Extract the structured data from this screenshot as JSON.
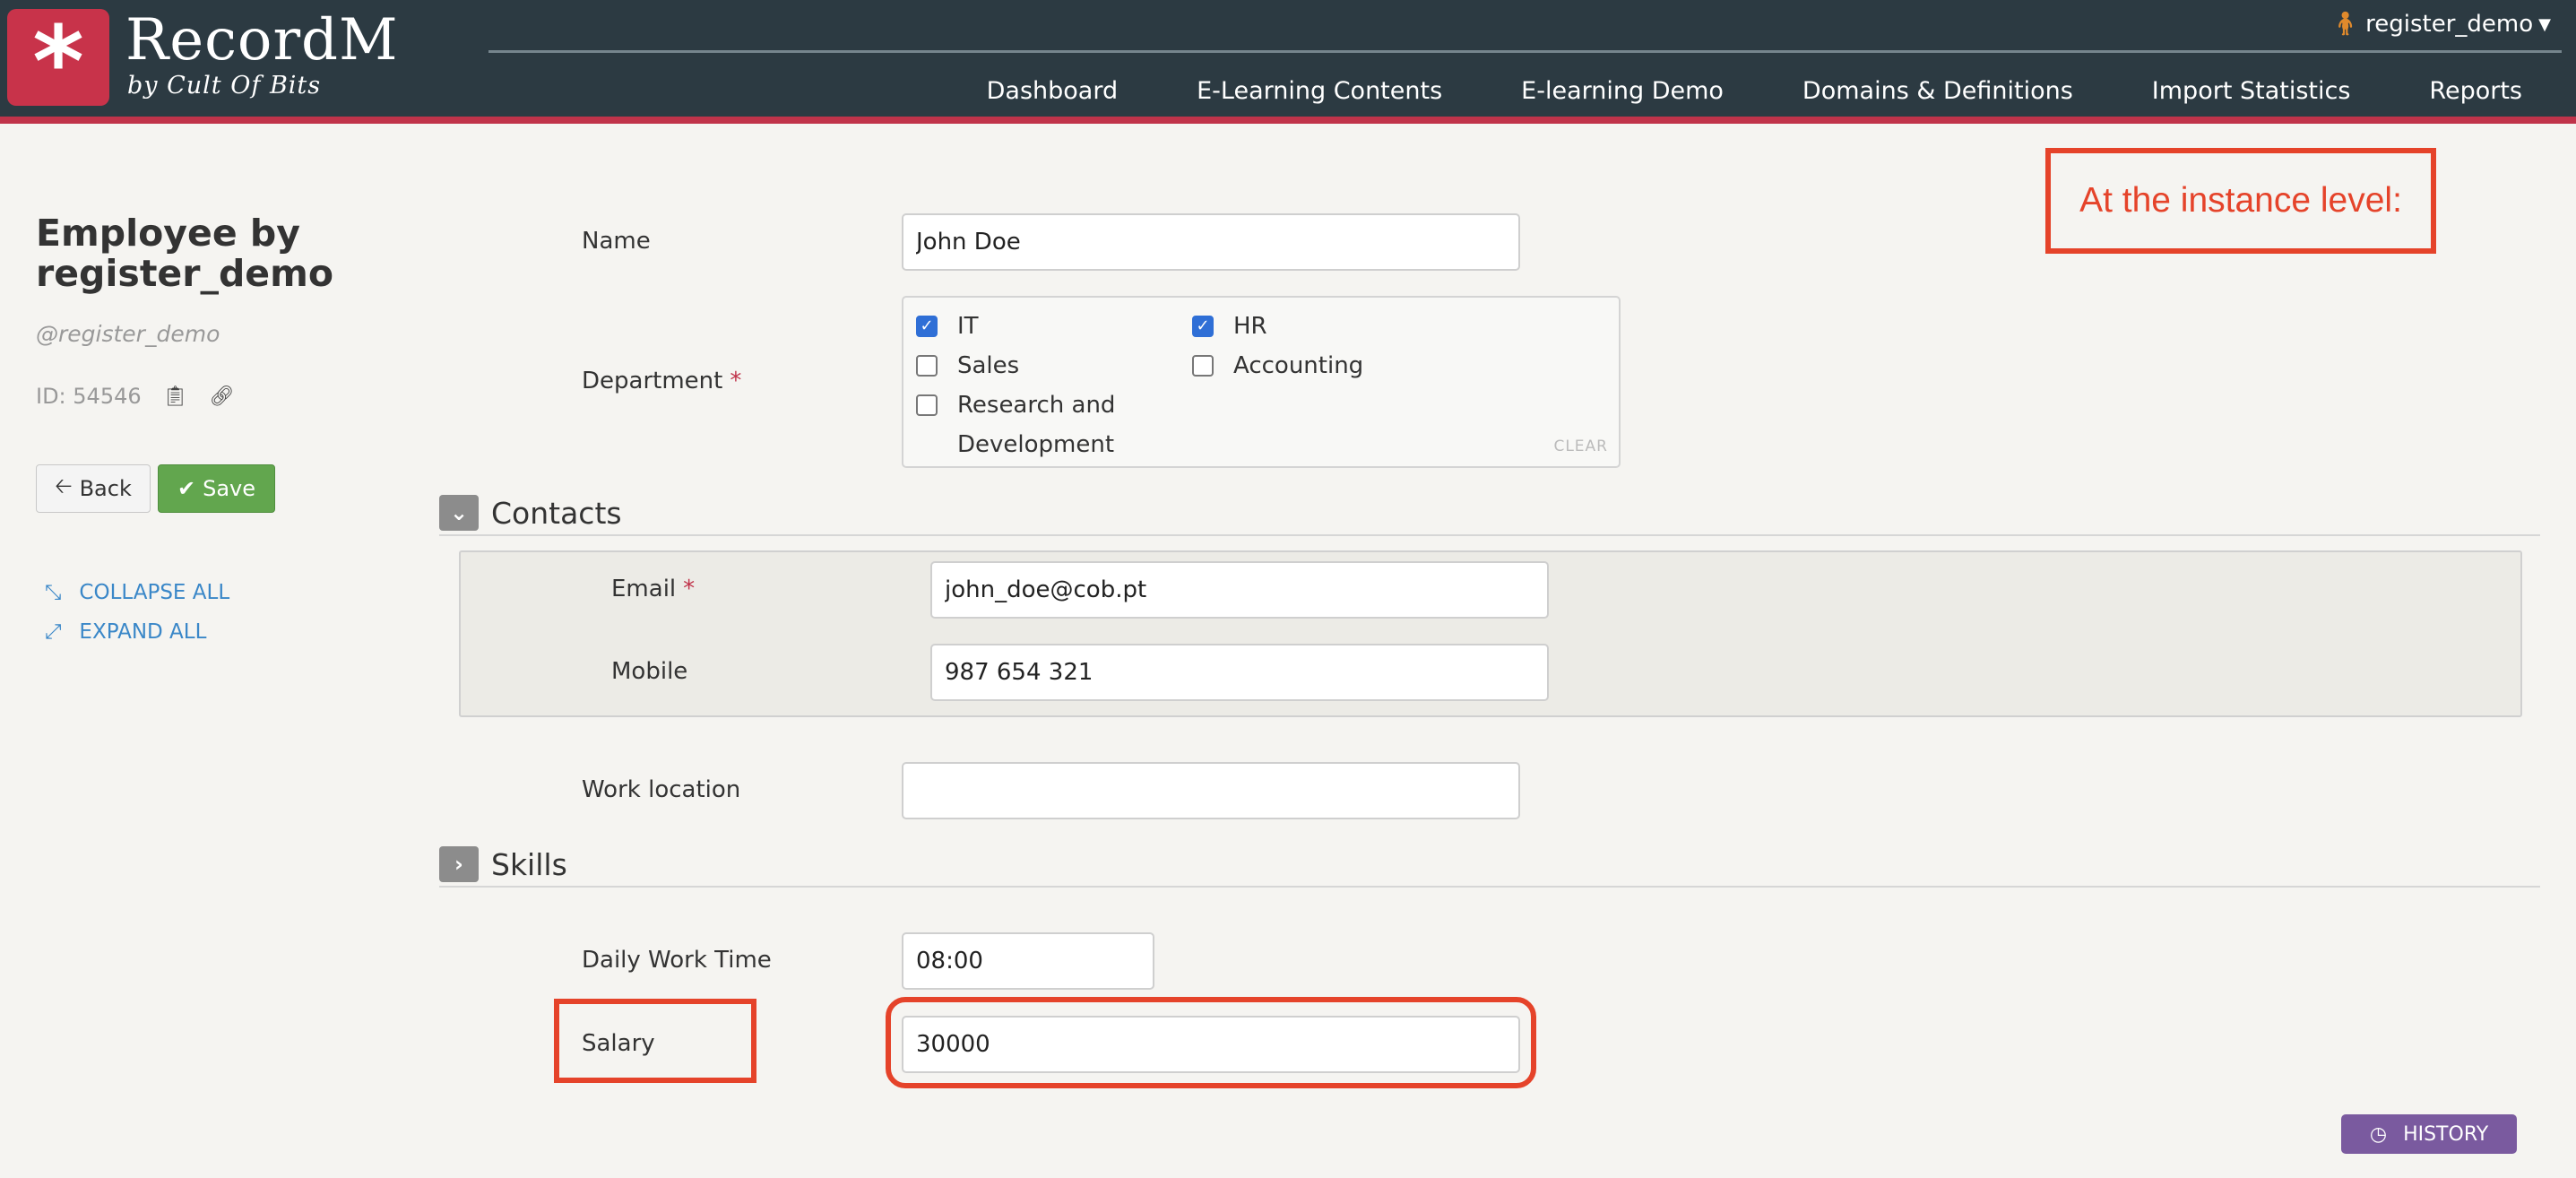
{
  "header": {
    "logo_symbol": "*",
    "app_name": "RecordM",
    "app_tagline": "by Cult Of Bits",
    "user": "register_demo",
    "nav": [
      "Dashboard",
      "E-Learning Contents",
      "E-learning Demo",
      "Domains & Definitions",
      "Import Statistics",
      "Reports"
    ]
  },
  "record": {
    "title": "Employee by register_demo",
    "handle": "@register_demo",
    "id_text": "ID: 54546",
    "back_label": "Back",
    "save_label": "Save",
    "collapse_all": "COLLAPSE ALL",
    "expand_all": "EXPAND ALL"
  },
  "form": {
    "name_label": "Name",
    "name_value": "John Doe",
    "department_label": "Department",
    "department_options": [
      {
        "label": "IT",
        "checked": true
      },
      {
        "label": "HR",
        "checked": true
      },
      {
        "label": "Sales",
        "checked": false
      },
      {
        "label": "Accounting",
        "checked": false
      },
      {
        "label": "Research and Development",
        "checked": false
      }
    ],
    "clear_label": "CLEAR",
    "contacts_title": "Contacts",
    "email_label": "Email",
    "email_value": "john_doe@cob.pt",
    "mobile_label": "Mobile",
    "mobile_value": "987 654 321",
    "work_location_label": "Work location",
    "work_location_value": "",
    "skills_title": "Skills",
    "daily_work_time_label": "Daily Work Time",
    "daily_work_time_value": "08:00",
    "salary_label": "Salary",
    "salary_value": "30000"
  },
  "annotation": {
    "note": "At the instance level:",
    "color": "#e5432a"
  },
  "history_label": "HISTORY",
  "colors": {
    "header_bg": "#2c3a42",
    "brand_red": "#c8334a",
    "save_green": "#62a64e",
    "link_blue": "#3a87c8",
    "history_purple": "#7a5a9f",
    "checkbox_blue": "#2f6fd6"
  }
}
